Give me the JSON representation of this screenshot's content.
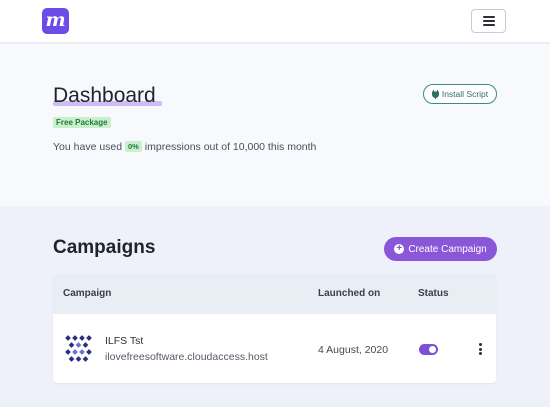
{
  "header": {
    "logo_letter": "m",
    "logo_color": "#6c4ce6",
    "menu_icon": "hamburger-icon"
  },
  "dashboard": {
    "title": "Dashboard",
    "package_badge": "Free Package",
    "usage_prefix": "You have used",
    "usage_percent": "0%",
    "usage_suffix": "impressions out of 10,000 this month",
    "install_button": "Install Script",
    "install_icon": "plug-icon"
  },
  "campaigns": {
    "title": "Campaigns",
    "create_button": "Create Campaign",
    "create_icon": "plus-circle-icon",
    "accent_color": "#8a57d8",
    "columns": [
      "Campaign",
      "Launched on",
      "Status"
    ],
    "rows": [
      {
        "name": "ILFS Tst",
        "site": "ilovefreesoftware.cloudaccess.host",
        "launched_on": "4 August, 2020",
        "status_enabled": true
      }
    ]
  }
}
